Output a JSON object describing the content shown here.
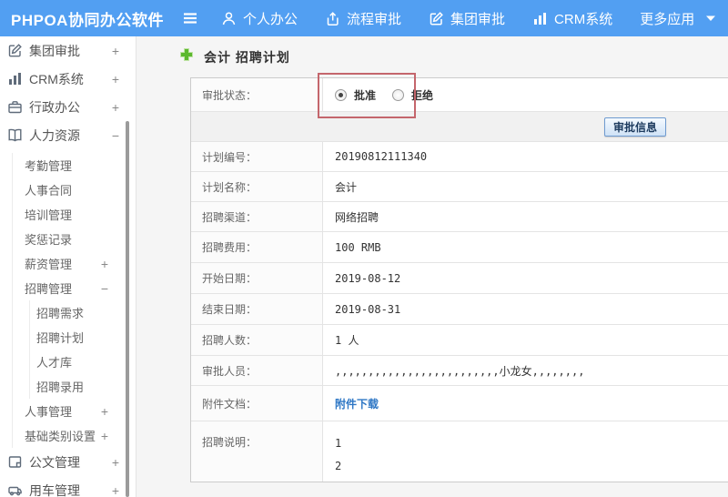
{
  "colors": {
    "header_blue": "#529ff2",
    "plus_green": "#5cb82e",
    "link_blue": "#2e77c5",
    "highlight_red": "#c4666c"
  },
  "header": {
    "logo": "PHPOA协同办公软件",
    "nav_items": [
      {
        "label": "个人办公",
        "icon": "user-icon"
      },
      {
        "label": "流程审批",
        "icon": "process-icon"
      },
      {
        "label": "集团审批",
        "icon": "edit-icon"
      },
      {
        "label": "CRM系统",
        "icon": "chart-icon"
      },
      {
        "label": "更多应用",
        "icon": "caret-down-icon"
      }
    ]
  },
  "sidebar": {
    "items": [
      {
        "label": "集团审批",
        "expander": "+",
        "icon": "edit-icon"
      },
      {
        "label": "CRM系统",
        "expander": "+",
        "icon": "chart-icon"
      },
      {
        "label": "行政办公",
        "expander": "+",
        "icon": "briefcase-icon"
      },
      {
        "label": "人力资源",
        "expander": "−",
        "icon": "book-icon"
      },
      {
        "label": "考勤管理"
      },
      {
        "label": "人事合同"
      },
      {
        "label": "培训管理"
      },
      {
        "label": "奖惩记录"
      },
      {
        "label": "薪资管理",
        "expander": "+"
      },
      {
        "label": "招聘管理",
        "expander": "−"
      },
      {
        "label": "招聘需求"
      },
      {
        "label": "招聘计划"
      },
      {
        "label": "人才库"
      },
      {
        "label": "招聘录用"
      },
      {
        "label": "人事管理",
        "expander": "+"
      },
      {
        "label": "基础类别设置",
        "expander": "+"
      },
      {
        "label": "公文管理",
        "expander": "+",
        "icon": "document-icon"
      },
      {
        "label": "用车管理",
        "expander": "+",
        "icon": "car-icon"
      }
    ]
  },
  "main": {
    "title": "会计 招聘计划",
    "approve_button": "审批信息",
    "status_row": {
      "label": "审批状态：",
      "options": [
        {
          "label": "批准",
          "checked": true
        },
        {
          "label": "拒绝",
          "checked": false
        }
      ]
    },
    "rows": [
      {
        "label": "计划编号：",
        "value": "20190812111340"
      },
      {
        "label": "计划名称：",
        "value": "会计"
      },
      {
        "label": "招聘渠道：",
        "value": "网络招聘"
      },
      {
        "label": "招聘费用：",
        "value": "100 RMB"
      },
      {
        "label": "开始日期：",
        "value": "2019-08-12"
      },
      {
        "label": "结束日期：",
        "value": "2019-08-31"
      },
      {
        "label": "招聘人数：",
        "value": "1 人"
      },
      {
        "label": "审批人员：",
        "value": ",,,,,,,,,,,,,,,,,,,,,,,,,小龙女,,,,,,,,"
      },
      {
        "label": "附件文档：",
        "value": "附件下载"
      },
      {
        "label": "招聘说明：",
        "lines": [
          "1",
          "2"
        ]
      }
    ]
  }
}
